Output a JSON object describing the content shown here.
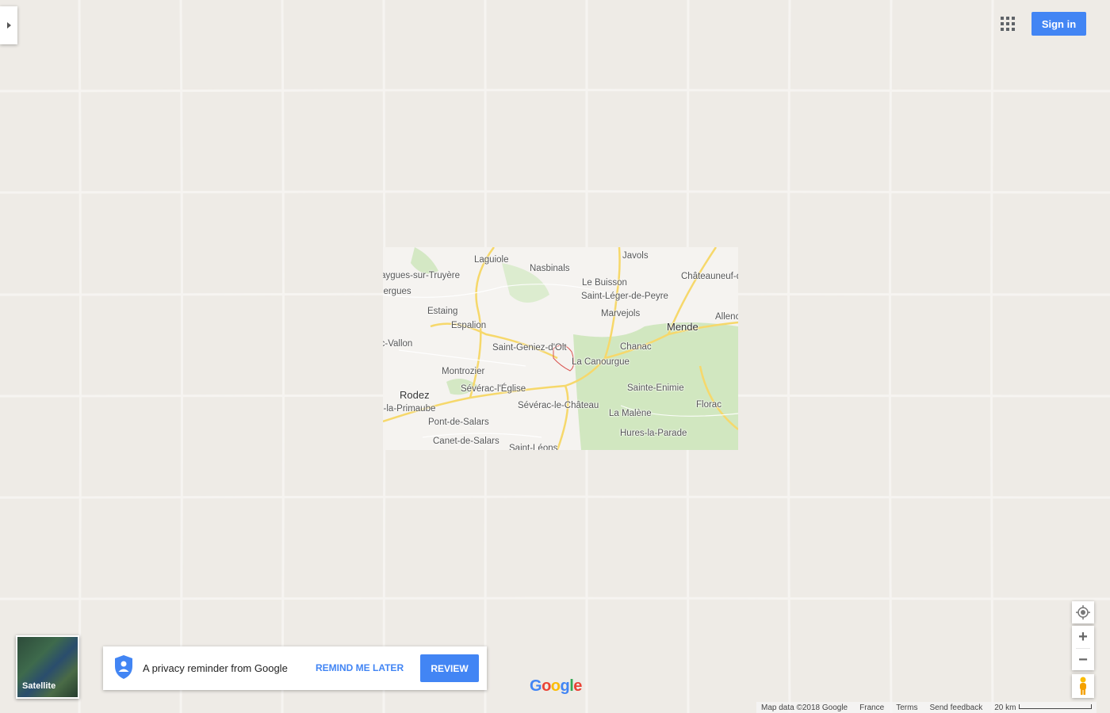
{
  "header": {
    "signin_label": "Sign in"
  },
  "map": {
    "places": [
      {
        "id": "laguiole",
        "label": "Laguiole"
      },
      {
        "id": "javols",
        "label": "Javols"
      },
      {
        "id": "nasbinals",
        "label": "Nasbinals"
      },
      {
        "id": "entraygues",
        "label": "Entraygues-sur-Truyère"
      },
      {
        "id": "chateauneuf",
        "label": "Châteauneuf-de-Randon"
      },
      {
        "id": "lebuisson",
        "label": "Le Buisson"
      },
      {
        "id": "senergues",
        "label": "Sénergues"
      },
      {
        "id": "saintleger",
        "label": "Saint-Léger-de-Peyre"
      },
      {
        "id": "estaing",
        "label": "Estaing"
      },
      {
        "id": "marvejols",
        "label": "Marvejols"
      },
      {
        "id": "allenc",
        "label": "Allenc"
      },
      {
        "id": "espalion",
        "label": "Espalion"
      },
      {
        "id": "mende",
        "label": "Mende"
      },
      {
        "id": "marcillac",
        "label": "Marcillac-Vallon"
      },
      {
        "id": "chanac",
        "label": "Chanac"
      },
      {
        "id": "saintgeniez",
        "label": "Saint-Geniez-d'Olt"
      },
      {
        "id": "lacanourgue",
        "label": "La Canourgue"
      },
      {
        "id": "montrozier",
        "label": "Montrozier"
      },
      {
        "id": "sainteenimie",
        "label": "Sainte-Enimie"
      },
      {
        "id": "rodez",
        "label": "Rodez"
      },
      {
        "id": "severaceglise",
        "label": "Sévérac-l'Église"
      },
      {
        "id": "lucprimaube",
        "label": "Luc-la-Primaube"
      },
      {
        "id": "severacchateau",
        "label": "Sévérac-le-Château"
      },
      {
        "id": "florac",
        "label": "Florac"
      },
      {
        "id": "lamalene",
        "label": "La Malène"
      },
      {
        "id": "pontdesalars",
        "label": "Pont-de-Salars"
      },
      {
        "id": "hures",
        "label": "Hures-la-Parade"
      },
      {
        "id": "canet",
        "label": "Canet-de-Salars"
      },
      {
        "id": "saintleons",
        "label": "Saint-Léons"
      }
    ],
    "colors": {
      "background": "#eeebe6",
      "roads": "#f6d86b",
      "park": "#c8e4b4",
      "boundary": "#d9534f"
    }
  },
  "map_type": {
    "label": "Satellite"
  },
  "privacy": {
    "message": "A privacy reminder from Google",
    "remind_later": "REMIND ME LATER",
    "review": "REVIEW",
    "accent": "#4285f4"
  },
  "logo": {
    "letters": [
      "G",
      "o",
      "o",
      "g",
      "l",
      "e"
    ],
    "colors": [
      "#4285f4",
      "#ea4335",
      "#fbbc05",
      "#4285f4",
      "#34a853",
      "#ea4335"
    ]
  },
  "controls": {
    "zoom_in": "+",
    "zoom_out": "−"
  },
  "footer": {
    "map_data": "Map data ©2018 Google",
    "region": "France",
    "terms": "Terms",
    "feedback": "Send feedback",
    "scale": "20 km"
  }
}
